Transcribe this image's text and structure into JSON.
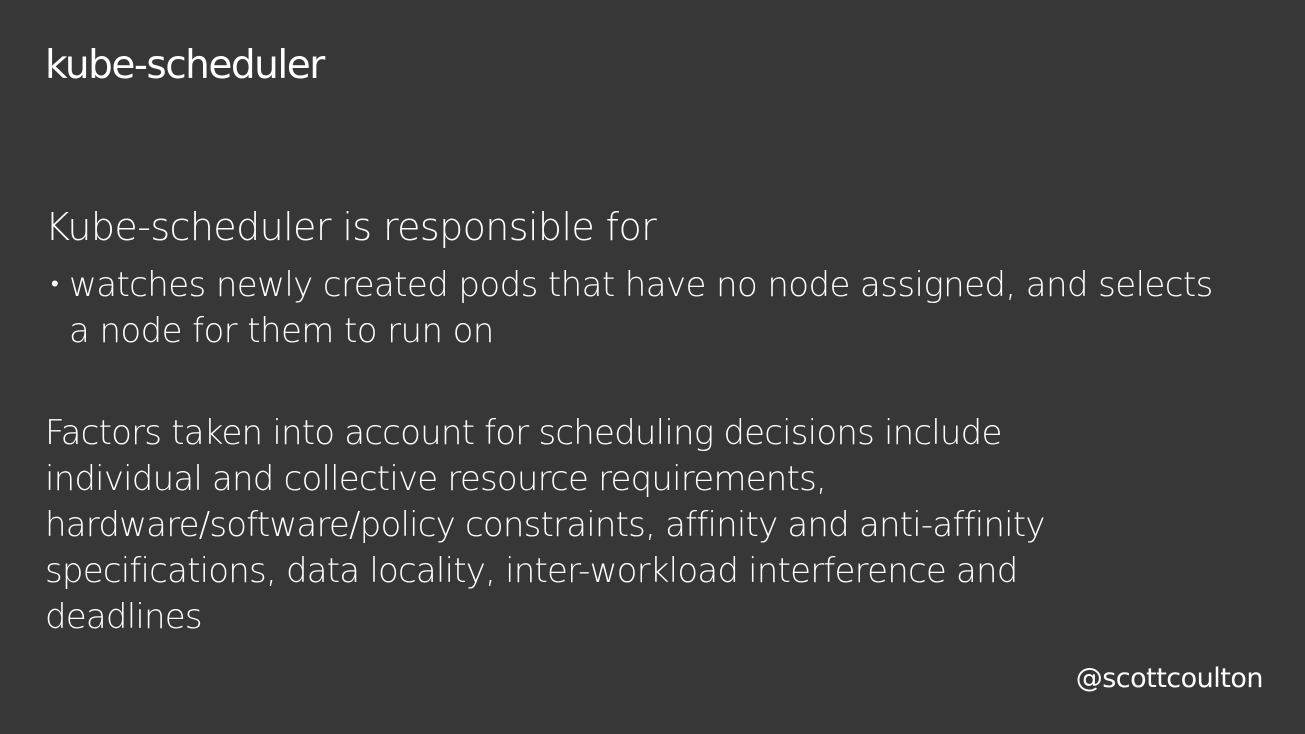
{
  "slide": {
    "title": "kube-scheduler",
    "intro": "Kube-scheduler is responsible for",
    "bullet_symbol": "•",
    "bullets": [
      "watches newly created pods that have no node assigned, and selects a node for them to run on"
    ],
    "factors": "Factors taken into account for scheduling decisions include individual and collective resource requirements, hardware/software/policy constraints, affinity and anti-affinity specifications, data locality, inter-workload interference and deadlines",
    "handle": "@scottcoulton"
  },
  "colors": {
    "background": "#373737",
    "text": "#ffffff"
  }
}
